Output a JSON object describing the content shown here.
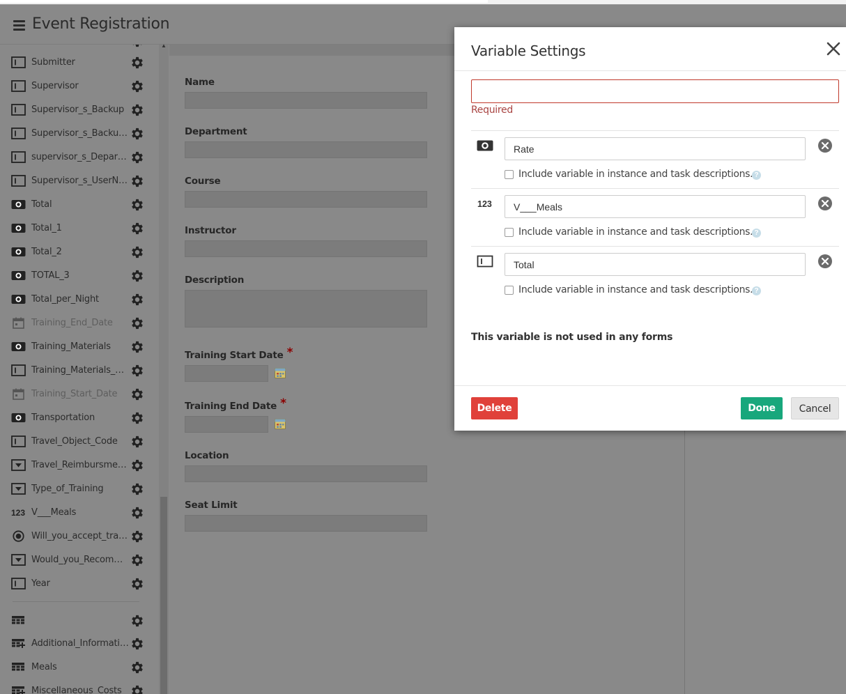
{
  "app": {
    "title": "Event Registration"
  },
  "sidebar": {
    "items": [
      {
        "label": "Submitter",
        "icon": "text-field-icon",
        "dim": false
      },
      {
        "label": "Supervisor",
        "icon": "text-field-icon",
        "dim": false
      },
      {
        "label": "Supervisor_s_Backup",
        "icon": "text-field-icon",
        "dim": false
      },
      {
        "label": "Supervisor_s_Backup...",
        "icon": "text-field-icon",
        "dim": false
      },
      {
        "label": "supervisor_s_Depart...",
        "icon": "text-field-icon",
        "dim": false
      },
      {
        "label": "Supervisor_s_UserNa...",
        "icon": "text-field-icon",
        "dim": false
      },
      {
        "label": "Total",
        "icon": "currency-icon",
        "dim": false
      },
      {
        "label": "Total_1",
        "icon": "currency-icon",
        "dim": false
      },
      {
        "label": "Total_2",
        "icon": "currency-icon",
        "dim": false
      },
      {
        "label": "TOTAL_3",
        "icon": "currency-icon",
        "dim": false
      },
      {
        "label": "Total_per_Night",
        "icon": "currency-icon",
        "dim": false
      },
      {
        "label": "Training_End_Date",
        "icon": "calendar-icon",
        "dim": true
      },
      {
        "label": "Training_Materials",
        "icon": "currency-icon",
        "dim": false
      },
      {
        "label": "Training_Materials_O...",
        "icon": "text-field-icon",
        "dim": false
      },
      {
        "label": "Training_Start_Date",
        "icon": "calendar-icon",
        "dim": true
      },
      {
        "label": "Transportation",
        "icon": "currency-icon",
        "dim": false
      },
      {
        "label": "Travel_Object_Code",
        "icon": "text-field-icon",
        "dim": false
      },
      {
        "label": "Travel_Reimbursmen...",
        "icon": "dropdown-icon",
        "dim": false
      },
      {
        "label": "Type_of_Training",
        "icon": "dropdown-icon",
        "dim": false
      },
      {
        "label": "V___Meals",
        "icon": "number-icon",
        "dim": false
      },
      {
        "label": "Will_you_accept_trav...",
        "icon": "radio-icon",
        "dim": false
      },
      {
        "label": "Would_you_Recomm...",
        "icon": "dropdown-icon",
        "dim": false
      },
      {
        "label": "Year",
        "icon": "text-field-icon",
        "dim": false
      }
    ],
    "grid_items": [
      {
        "label": "",
        "icon": "grid-icon"
      },
      {
        "label": "Additional_Information",
        "icon": "grid-add-icon"
      },
      {
        "label": "Meals",
        "icon": "grid-icon"
      },
      {
        "label": "Miscellaneous_Costs",
        "icon": "grid-add-icon"
      }
    ]
  },
  "form": {
    "fields": [
      {
        "label": "Name",
        "type": "text",
        "required": false
      },
      {
        "label": "Department",
        "type": "text",
        "required": false
      },
      {
        "label": "Course",
        "type": "text",
        "required": false
      },
      {
        "label": "Instructor",
        "type": "text",
        "required": false
      },
      {
        "label": "Description",
        "type": "textarea",
        "required": false
      },
      {
        "label": "Training Start Date",
        "type": "date",
        "required": true
      },
      {
        "label": "Training End Date",
        "type": "date",
        "required": true
      },
      {
        "label": "Location",
        "type": "text",
        "required": false
      },
      {
        "label": "Seat Limit",
        "type": "text",
        "required": false
      }
    ],
    "required_marker": "*"
  },
  "modal": {
    "title": "Variable Settings",
    "name_value": "",
    "required_msg": "Required",
    "variables": [
      {
        "icon": "currency-icon",
        "value": "Rate",
        "checkbox_label": "Include variable in instance and task descriptions.",
        "checked": false
      },
      {
        "icon": "number-icon",
        "value": "V___Meals",
        "checkbox_label": "Include variable in instance and task descriptions.",
        "checked": false
      },
      {
        "icon": "text-field-icon",
        "value": "Total",
        "checkbox_label": "Include variable in instance and task descriptions.",
        "checked": false
      }
    ],
    "help_glyph": "?",
    "not_used_msg": "This variable is not used in any forms",
    "buttons": {
      "delete": "Delete",
      "done": "Done",
      "cancel": "Cancel"
    }
  },
  "colors": {
    "overlay": "#898989",
    "delete": "#e0413a",
    "done": "#18a77c",
    "error": "#a94442"
  }
}
